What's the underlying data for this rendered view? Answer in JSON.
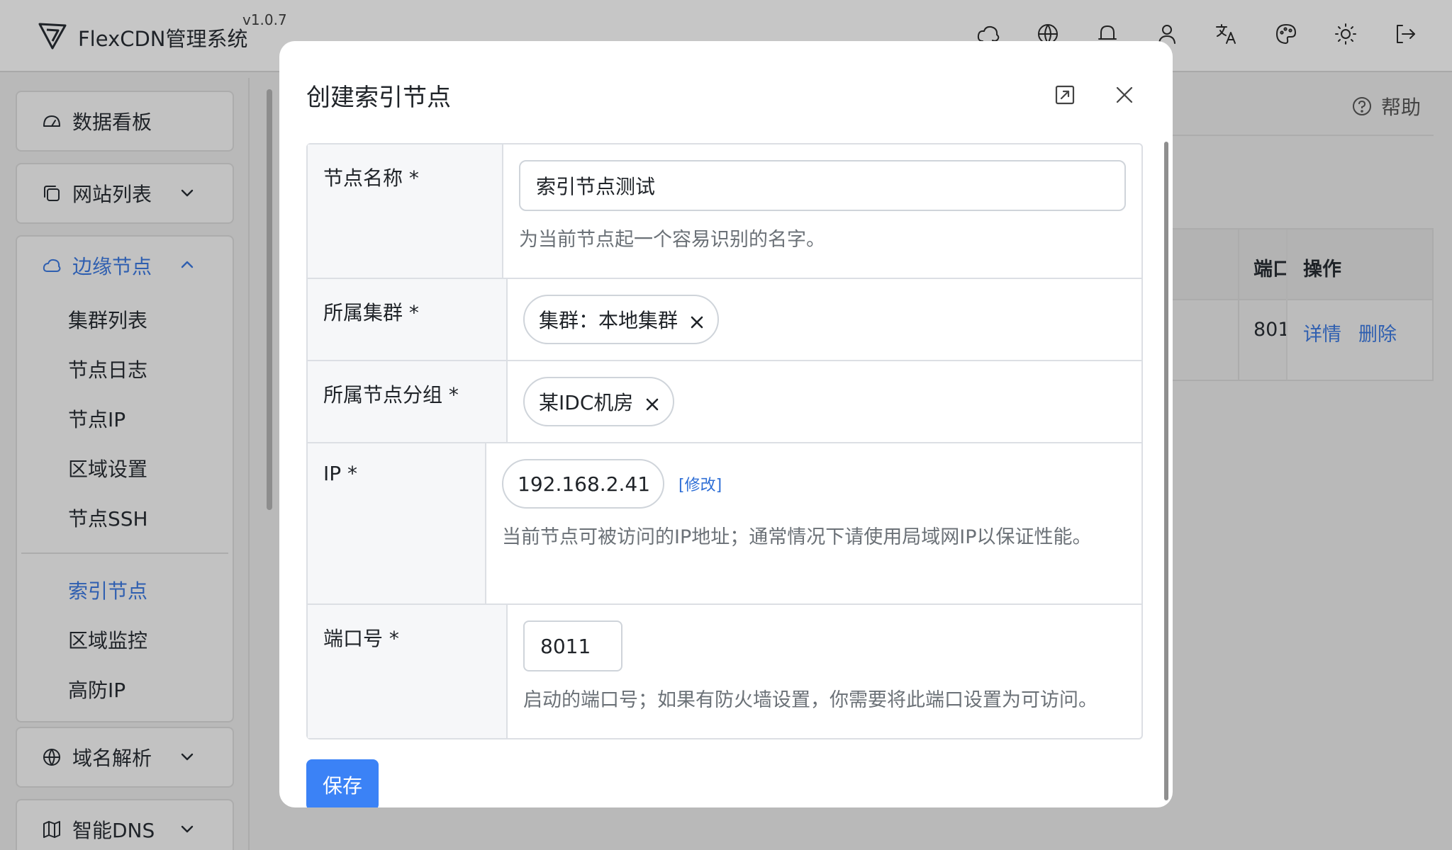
{
  "app": {
    "name": "FlexCDN管理系统",
    "version": "v1.0.7"
  },
  "topbar": {
    "icons": [
      "cloud-icon",
      "globe-icon",
      "bell-icon",
      "user-icon",
      "translate-icon",
      "palette-icon",
      "sun-icon",
      "logout-icon"
    ]
  },
  "sidebar": {
    "dashboard": "数据看板",
    "websites": "网站列表",
    "edge_nodes": "边缘节点",
    "edge_sub": [
      "集群列表",
      "节点日志",
      "节点IP",
      "区域设置",
      "节点SSH"
    ],
    "edge_sub2": [
      "索引节点",
      "区域监控",
      "高防IP"
    ],
    "dns": "域名解析",
    "smart_dns": "智能DNS"
  },
  "content": {
    "help": "帮助",
    "table": {
      "col_port": "端口",
      "col_actions": "操作",
      "row_port": "801",
      "detail": "详情",
      "delete": "删除"
    }
  },
  "modal": {
    "title": "创建索引节点",
    "fields": {
      "name": {
        "label": "节点名称 *",
        "value": "索引节点测试",
        "help": "为当前节点起一个容易识别的名字。"
      },
      "cluster": {
        "label": "所属集群 *",
        "chip": "集群：本地集群"
      },
      "group": {
        "label": "所属节点分组 *",
        "chip": "某IDC机房"
      },
      "ip": {
        "label": "IP *",
        "value": "192.168.2.41",
        "edit": "[修改]",
        "help": "当前节点可被访问的IP地址；通常情况下请使用局域网IP以保证性能。"
      },
      "port": {
        "label": "端口号 *",
        "value": "8011",
        "help": "启动的端口号；如果有防火墙设置，你需要将此端口设置为可访问。"
      }
    },
    "save": "保存"
  },
  "colors": {
    "accent": "#3b82f6",
    "link": "#2f6fd6",
    "active_menu": "#2f5fb0"
  }
}
